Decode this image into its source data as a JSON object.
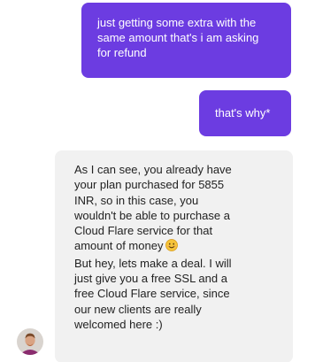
{
  "messages": [
    {
      "sender": "user",
      "text": "just getting some extra with the\nsame amount that's i am asking\nfor refund"
    },
    {
      "sender": "user",
      "text": "that's why*"
    },
    {
      "sender": "agent",
      "text_part1": "As I can see, you already have\nyour plan purchased for 5855\nINR, so in this case, you\nwouldn't be able to purchase a\nCloud Flare service for that\namount of money",
      "text_part2": "But hey, lets make a deal. I will\njust give you a free SSL and a\nfree Cloud Flare service, since\nour new clients are really\nwelcomed here :)",
      "emoji": "smiling-face-icon"
    }
  ],
  "colors": {
    "user_bubble": "#6c3ce1",
    "agent_bubble": "#f1f1f1",
    "agent_text": "#222222"
  },
  "agent_avatar": "agent-avatar-photo"
}
